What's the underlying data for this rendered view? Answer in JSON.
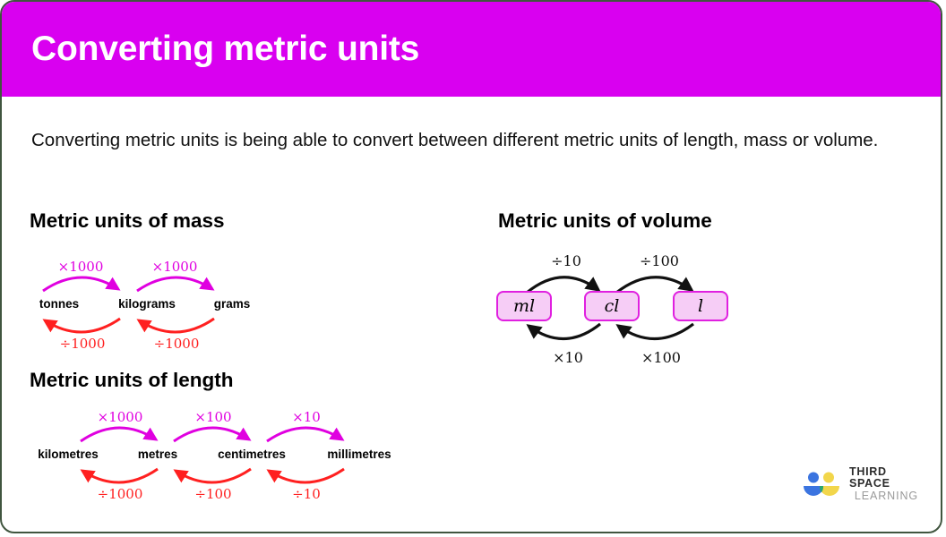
{
  "banner": {
    "title": "Converting metric units",
    "color": "#d900f0"
  },
  "intro": {
    "text": "Converting metric units is being able to convert between different metric units of length, mass or volume."
  },
  "sections": {
    "mass": {
      "heading": "Metric units of mass",
      "units": [
        "tonnes",
        "kilograms",
        "grams"
      ],
      "multiply_labels": [
        "×1000",
        "×1000"
      ],
      "divide_labels": [
        "÷1000",
        "÷1000"
      ],
      "multiply_color": "#e000e0",
      "divide_color": "#ff2020"
    },
    "length": {
      "heading": "Metric units of length",
      "units": [
        "kilometres",
        "metres",
        "centimetres",
        "millimetres"
      ],
      "multiply_labels": [
        "×1000",
        "×100",
        "×10"
      ],
      "divide_labels": [
        "÷1000",
        "÷100",
        "÷10"
      ],
      "multiply_color": "#e000e0",
      "divide_color": "#ff2020"
    },
    "volume": {
      "heading": "Metric units of volume",
      "units": [
        "ml",
        "cl",
        "l"
      ],
      "top_labels": [
        "÷10",
        "÷100"
      ],
      "bottom_labels": [
        "×10",
        "×100"
      ],
      "box_fill": "#f6cdf6",
      "box_border": "#e020e0",
      "arrow_color": "#111111"
    }
  },
  "logo": {
    "line1": "THIRD SPACE",
    "line2": "LEARNING",
    "blue": "#3b74e0",
    "yellow": "#f2d64b",
    "green": "#2fa municipality"
  }
}
